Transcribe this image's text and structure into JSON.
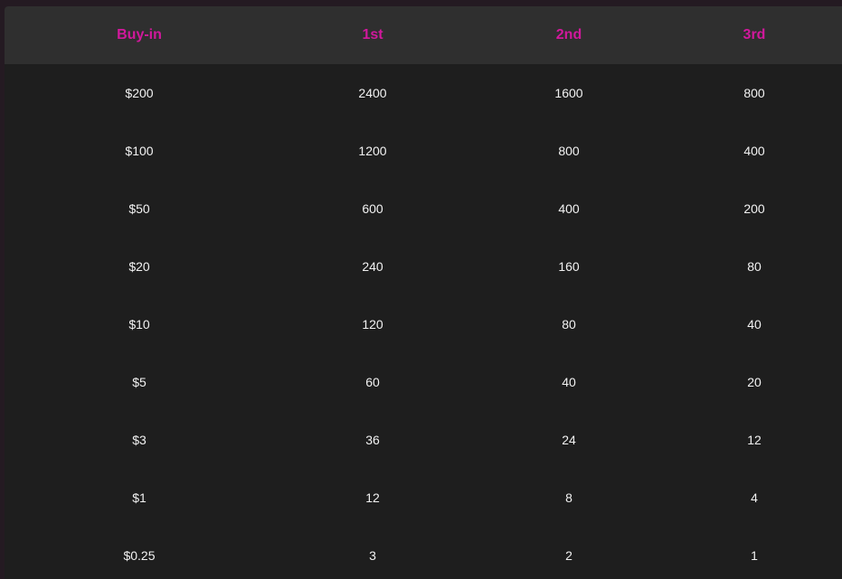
{
  "colors": {
    "accent": "#d1189c",
    "header_bg": "#2f2f2f",
    "table_bg": "#1e1e1e",
    "text": "#f2f2f2",
    "page_bg": "#241a22"
  },
  "table": {
    "headers": [
      "Buy-in",
      "1st",
      "2nd",
      "3rd"
    ],
    "rows": [
      [
        "$200",
        "2400",
        "1600",
        "800"
      ],
      [
        "$100",
        "1200",
        "800",
        "400"
      ],
      [
        "$50",
        "600",
        "400",
        "200"
      ],
      [
        "$20",
        "240",
        "160",
        "80"
      ],
      [
        "$10",
        "120",
        "80",
        "40"
      ],
      [
        "$5",
        "60",
        "40",
        "20"
      ],
      [
        "$3",
        "36",
        "24",
        "12"
      ],
      [
        "$1",
        "12",
        "8",
        "4"
      ],
      [
        "$0.25",
        "3",
        "2",
        "1"
      ]
    ]
  }
}
